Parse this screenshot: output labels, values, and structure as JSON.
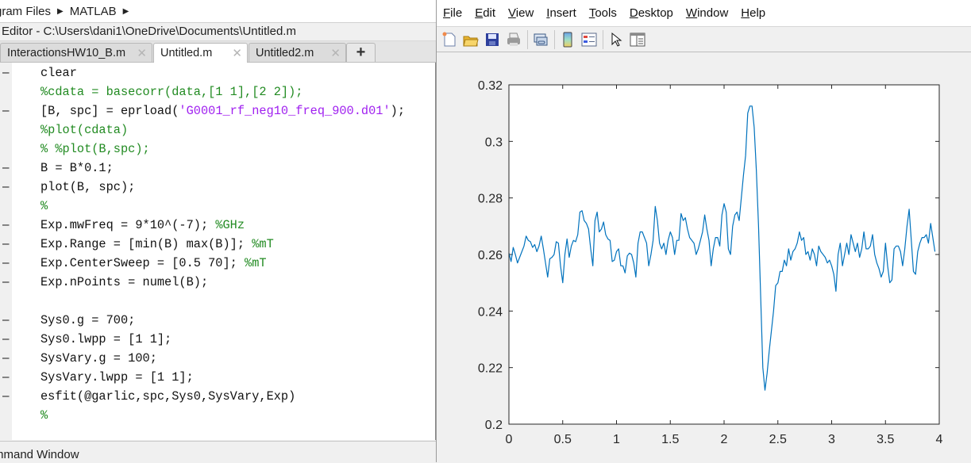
{
  "editor": {
    "breadcrumb": [
      "gram Files",
      "MATLAB"
    ],
    "title": "Editor - C:\\Users\\dani1\\OneDrive\\Documents\\Untitled.m",
    "tabs": [
      {
        "label": "InteractionsHW10_B.m",
        "active": false
      },
      {
        "label": "Untitled.m",
        "active": true
      },
      {
        "label": "Untitled2.m",
        "active": false
      }
    ],
    "add_tab_label": "+",
    "close_glyph": "✕",
    "lines": [
      {
        "marker": "–",
        "parts": [
          {
            "t": "clear",
            "k": "code"
          }
        ]
      },
      {
        "marker": "",
        "parts": [
          {
            "t": "%cdata = basecorr(data,[1 1],[2 2]);",
            "k": "comment"
          }
        ]
      },
      {
        "marker": "–",
        "parts": [
          {
            "t": "[B, spc] = eprload(",
            "k": "code"
          },
          {
            "t": "'G0001_rf_neg10_freq_900.d01'",
            "k": "string"
          },
          {
            "t": ");",
            "k": "code"
          }
        ]
      },
      {
        "marker": "",
        "parts": [
          {
            "t": "%plot(cdata)",
            "k": "comment"
          }
        ]
      },
      {
        "marker": "",
        "parts": [
          {
            "t": "% %plot(B,spc);",
            "k": "comment"
          }
        ]
      },
      {
        "marker": "–",
        "parts": [
          {
            "t": "B = B*0.1;",
            "k": "code"
          }
        ]
      },
      {
        "marker": "–",
        "parts": [
          {
            "t": "plot(B, spc);",
            "k": "code"
          }
        ]
      },
      {
        "marker": "",
        "parts": [
          {
            "t": "%",
            "k": "comment"
          }
        ]
      },
      {
        "marker": "–",
        "parts": [
          {
            "t": "Exp.mwFreq = 9*10^(-7); ",
            "k": "code"
          },
          {
            "t": "%GHz",
            "k": "comment"
          }
        ]
      },
      {
        "marker": "–",
        "parts": [
          {
            "t": "Exp.Range = [min(B) max(B)]; ",
            "k": "code"
          },
          {
            "t": "%mT",
            "k": "comment"
          }
        ]
      },
      {
        "marker": "–",
        "parts": [
          {
            "t": "Exp.CenterSweep = [0.5 70]; ",
            "k": "code"
          },
          {
            "t": "%mT",
            "k": "comment"
          }
        ]
      },
      {
        "marker": "–",
        "parts": [
          {
            "t": "Exp.nPoints = numel(B);",
            "k": "code"
          }
        ]
      },
      {
        "marker": "",
        "parts": []
      },
      {
        "marker": "–",
        "parts": [
          {
            "t": "Sys0.g = 700;",
            "k": "code"
          }
        ]
      },
      {
        "marker": "–",
        "parts": [
          {
            "t": "Sys0.lwpp = [1 1];",
            "k": "code"
          }
        ]
      },
      {
        "marker": "–",
        "parts": [
          {
            "t": "SysVary.g = 100;",
            "k": "code"
          }
        ]
      },
      {
        "marker": "–",
        "parts": [
          {
            "t": "SysVary.lwpp = [1 1];",
            "k": "code"
          }
        ]
      },
      {
        "marker": "–",
        "parts": [
          {
            "t": "esfit(@garlic,spc,Sys0,SysVary,Exp)",
            "k": "code"
          }
        ]
      },
      {
        "marker": "",
        "parts": [
          {
            "t": "%",
            "k": "comment"
          }
        ]
      }
    ],
    "command_window_label": "mmand Window"
  },
  "figure": {
    "menu": [
      {
        "label": "File",
        "mnemonic": "F"
      },
      {
        "label": "Edit",
        "mnemonic": "E"
      },
      {
        "label": "View",
        "mnemonic": "V"
      },
      {
        "label": "Insert",
        "mnemonic": "I"
      },
      {
        "label": "Tools",
        "mnemonic": "T"
      },
      {
        "label": "Desktop",
        "mnemonic": "D"
      },
      {
        "label": "Window",
        "mnemonic": "W"
      },
      {
        "label": "Help",
        "mnemonic": "H"
      }
    ],
    "toolbar": [
      "new-figure-icon",
      "open-file-icon",
      "save-icon",
      "print-icon",
      "link-plot-icon",
      "colorbar-icon",
      "legend-icon",
      "pointer-icon",
      "property-inspector-icon"
    ],
    "line_color": "#0072bd"
  },
  "chart_data": {
    "type": "line",
    "title": "",
    "xlabel": "",
    "ylabel": "",
    "xlim": [
      0,
      4
    ],
    "ylim": [
      0.2,
      0.32
    ],
    "xticks": [
      "0",
      "0.5",
      "1",
      "1.5",
      "2",
      "2.5",
      "3",
      "3.5",
      "4"
    ],
    "yticks": [
      "0.2",
      "0.22",
      "0.24",
      "0.26",
      "0.28",
      "0.3",
      "0.32"
    ],
    "grid": false,
    "legend": "none",
    "series": [
      {
        "name": "spc",
        "color": "#0072bd",
        "x": [
          0.0,
          0.02,
          0.04,
          0.06,
          0.08,
          0.1,
          0.12,
          0.14,
          0.16,
          0.18,
          0.2,
          0.22,
          0.24,
          0.26,
          0.28,
          0.3,
          0.32,
          0.34,
          0.36,
          0.38,
          0.4,
          0.42,
          0.44,
          0.46,
          0.48,
          0.5,
          0.52,
          0.54,
          0.56,
          0.58,
          0.6,
          0.62,
          0.64,
          0.66,
          0.68,
          0.7,
          0.72,
          0.74,
          0.76,
          0.78,
          0.8,
          0.82,
          0.84,
          0.86,
          0.88,
          0.9,
          0.92,
          0.94,
          0.96,
          0.98,
          1.0,
          1.02,
          1.04,
          1.06,
          1.08,
          1.1,
          1.12,
          1.14,
          1.16,
          1.18,
          1.2,
          1.22,
          1.24,
          1.26,
          1.28,
          1.3,
          1.32,
          1.34,
          1.36,
          1.38,
          1.4,
          1.42,
          1.44,
          1.46,
          1.48,
          1.5,
          1.52,
          1.54,
          1.56,
          1.58,
          1.6,
          1.62,
          1.64,
          1.66,
          1.68,
          1.7,
          1.72,
          1.74,
          1.76,
          1.78,
          1.8,
          1.82,
          1.84,
          1.86,
          1.88,
          1.9,
          1.92,
          1.94,
          1.96,
          1.98,
          2.0,
          2.02,
          2.04,
          2.06,
          2.08,
          2.1,
          2.12,
          2.14,
          2.16,
          2.18,
          2.2,
          2.22,
          2.24,
          2.26,
          2.28,
          2.3,
          2.32,
          2.34,
          2.36,
          2.38,
          2.4,
          2.42,
          2.44,
          2.46,
          2.48,
          2.5,
          2.52,
          2.54,
          2.56,
          2.58,
          2.6,
          2.62,
          2.64,
          2.66,
          2.68,
          2.7,
          2.72,
          2.74,
          2.76,
          2.78,
          2.8,
          2.82,
          2.84,
          2.86,
          2.88,
          2.9,
          2.92,
          2.94,
          2.96,
          2.98,
          3.0,
          3.02,
          3.04,
          3.06,
          3.08,
          3.1,
          3.12,
          3.14,
          3.16,
          3.18,
          3.2,
          3.22,
          3.24,
          3.26,
          3.28,
          3.3,
          3.32,
          3.34,
          3.36,
          3.38,
          3.4,
          3.42,
          3.44,
          3.46,
          3.48,
          3.5,
          3.52,
          3.54,
          3.56,
          3.58,
          3.6,
          3.62,
          3.64,
          3.66,
          3.68,
          3.7,
          3.72,
          3.74,
          3.76,
          3.78,
          3.8,
          3.82,
          3.84,
          3.86,
          3.88,
          3.9,
          3.92,
          3.94,
          3.96,
          3.98,
          4.0
        ],
        "y": [
          0.2605,
          0.2575,
          0.2625,
          0.26,
          0.257,
          0.259,
          0.261,
          0.263,
          0.2665,
          0.265,
          0.2645,
          0.2625,
          0.2635,
          0.261,
          0.263,
          0.2665,
          0.262,
          0.257,
          0.252,
          0.2585,
          0.259,
          0.26,
          0.2645,
          0.264,
          0.256,
          0.25,
          0.26,
          0.2655,
          0.259,
          0.263,
          0.265,
          0.2645,
          0.267,
          0.275,
          0.2755,
          0.272,
          0.271,
          0.269,
          0.262,
          0.256,
          0.272,
          0.275,
          0.268,
          0.269,
          0.2715,
          0.267,
          0.2655,
          0.265,
          0.2575,
          0.258,
          0.261,
          0.262,
          0.256,
          0.256,
          0.2535,
          0.2595,
          0.2605,
          0.26,
          0.257,
          0.252,
          0.264,
          0.268,
          0.268,
          0.266,
          0.264,
          0.256,
          0.26,
          0.265,
          0.277,
          0.272,
          0.264,
          0.262,
          0.264,
          0.26,
          0.265,
          0.268,
          0.266,
          0.26,
          0.265,
          0.265,
          0.2745,
          0.272,
          0.273,
          0.269,
          0.266,
          0.265,
          0.264,
          0.26,
          0.262,
          0.265,
          0.268,
          0.274,
          0.269,
          0.265,
          0.256,
          0.262,
          0.266,
          0.266,
          0.263,
          0.274,
          0.278,
          0.275,
          0.262,
          0.26,
          0.27,
          0.274,
          0.275,
          0.272,
          0.28,
          0.288,
          0.295,
          0.31,
          0.3125,
          0.3125,
          0.305,
          0.29,
          0.27,
          0.245,
          0.22,
          0.212,
          0.218,
          0.226,
          0.233,
          0.24,
          0.249,
          0.25,
          0.254,
          0.254,
          0.258,
          0.256,
          0.262,
          0.258,
          0.261,
          0.262,
          0.264,
          0.268,
          0.265,
          0.266,
          0.26,
          0.261,
          0.258,
          0.262,
          0.26,
          0.256,
          0.263,
          0.261,
          0.26,
          0.259,
          0.257,
          0.258,
          0.256,
          0.253,
          0.247,
          0.26,
          0.264,
          0.256,
          0.26,
          0.264,
          0.26,
          0.267,
          0.264,
          0.261,
          0.264,
          0.259,
          0.262,
          0.268,
          0.262,
          0.262,
          0.263,
          0.267,
          0.26,
          0.257,
          0.255,
          0.252,
          0.254,
          0.264,
          0.256,
          0.25,
          0.251,
          0.262,
          0.263,
          0.263,
          0.261,
          0.256,
          0.262,
          0.27,
          0.276,
          0.265,
          0.254,
          0.253,
          0.261,
          0.264,
          0.266,
          0.266,
          0.267,
          0.264,
          0.271,
          0.266,
          0.261
        ]
      }
    ]
  }
}
